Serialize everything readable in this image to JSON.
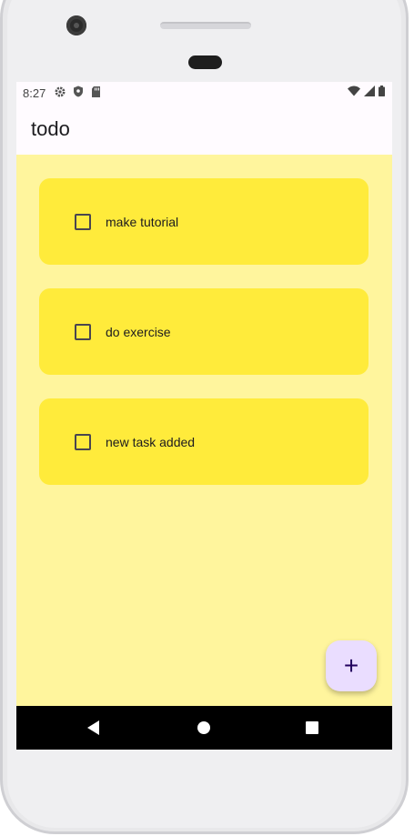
{
  "status_bar": {
    "time": "8:27",
    "icons_left": [
      "gear-icon",
      "shield-icon",
      "sd-card-icon"
    ],
    "icons_right": [
      "wifi-icon",
      "signal-icon",
      "battery-icon"
    ]
  },
  "app_bar": {
    "title": "todo"
  },
  "tasks": [
    {
      "label": "make tutorial",
      "checked": false
    },
    {
      "label": "do exercise",
      "checked": false
    },
    {
      "label": "new task added",
      "checked": false
    }
  ],
  "fab": {
    "symbol": "+"
  },
  "colors": {
    "background": "#fff59d",
    "card": "#ffeb3b",
    "fab": "#eaddff",
    "app_bar": "#fffbff"
  }
}
